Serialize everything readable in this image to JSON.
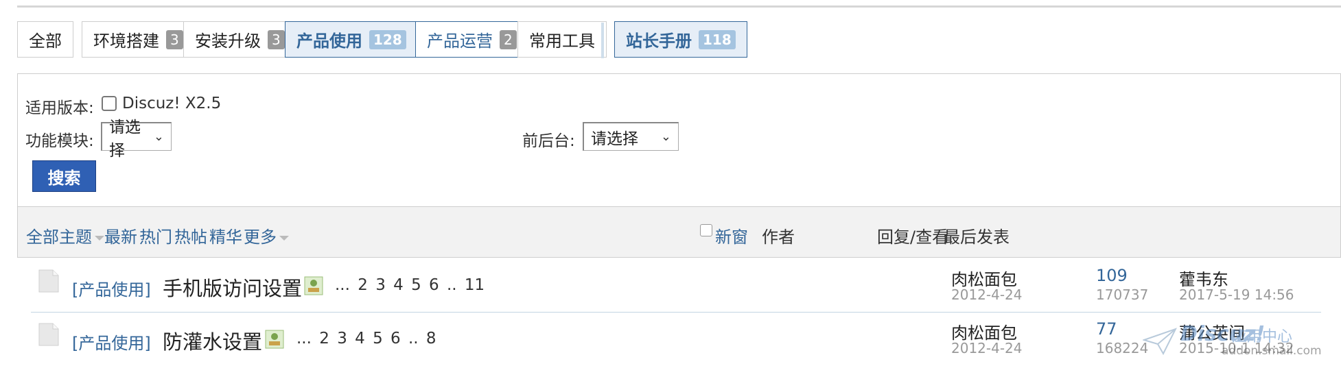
{
  "tabs": [
    {
      "label": "全部",
      "count": ""
    },
    {
      "label": "环境搭建",
      "count": "3"
    },
    {
      "label": "安装升级",
      "count": "3"
    },
    {
      "label": "产品使用",
      "count": "128"
    },
    {
      "label": "产品运营",
      "count": "2"
    },
    {
      "label": "常用工具",
      "count": ""
    },
    {
      "label": "站长手册",
      "count": "118"
    }
  ],
  "filter": {
    "version_label": "适用版本:",
    "version_option": "Discuz! X2.5",
    "module_label": "功能模块:",
    "module_value": "请选择",
    "side_label": "前后台:",
    "side_value": "请选择",
    "search_label": "搜索"
  },
  "list_header": {
    "all_threads": "全部主题",
    "latest": "最新",
    "hot": "热门",
    "hot_posts": "热帖",
    "digest": "精华",
    "more": "更多",
    "new_window": "新窗",
    "author": "作者",
    "reply_view": "回复/查看",
    "last_post": "最后发表"
  },
  "threads": [
    {
      "category": "[产品使用]",
      "title": "手机版访问设置",
      "pages": "... 2 3 4 5 6 .. 11",
      "author": "肉松面包",
      "author_date": "2012-4-24",
      "replies": "109",
      "views": "170737",
      "last_user": "藿韦东",
      "last_date": "2017-5-19 14:56"
    },
    {
      "category": "[产品使用]",
      "title": "防灌水设置",
      "pages": "... 2 3 4 5 6 .. 8",
      "author": "肉松面包",
      "author_date": "2012-4-24",
      "replies": "77",
      "views": "168224",
      "last_user": "蒲公英间",
      "last_date": "2015-10-1 14:32"
    }
  ],
  "watermark": {
    "brand": "Discuz!",
    "site": "应用中心",
    "email": "addon.smail.com"
  },
  "colors": {
    "link": "#336699",
    "accent_button": "#2f60b4",
    "active_tab_bg": "#e6eef7",
    "muted": "#999999"
  }
}
